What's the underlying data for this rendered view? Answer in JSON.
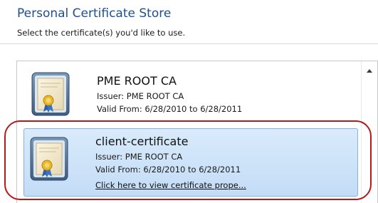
{
  "dialog": {
    "title": "Personal Certificate Store",
    "subtitle": "Select the certificate(s) you'd like to use."
  },
  "certificates": [
    {
      "name": "PME ROOT CA",
      "issuer": "Issuer: PME ROOT CA",
      "valid": "Valid From: 6/28/2010 to 6/28/2011",
      "selected": false
    },
    {
      "name": "client-certificate",
      "issuer": "Issuer: PME ROOT CA",
      "valid": "Valid From: 6/28/2010 to 6/28/2011",
      "link": "Click here to view certificate prope...",
      "selected": true
    }
  ],
  "icons": {
    "certificate": "certificate-icon",
    "scroll_up": "scroll-up-arrow-icon"
  },
  "colors": {
    "title": "#1e4f8f",
    "selection_bg": "#c3dcf6",
    "selection_border": "#84b1de",
    "highlight_ring": "#b41a1a"
  }
}
